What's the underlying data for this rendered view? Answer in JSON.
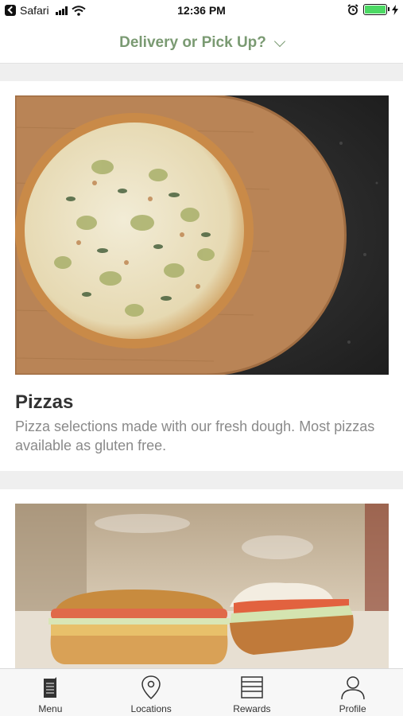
{
  "status_bar": {
    "back_app": "Safari",
    "time": "12:36 PM"
  },
  "header": {
    "title": "Delivery or Pick Up?",
    "accent_color": "#7a9a72"
  },
  "categories": [
    {
      "title": "Pizzas",
      "description": "Pizza selections made with our fresh dough. Most pizzas available as gluten free.",
      "image": "artichoke-pizza-photo"
    },
    {
      "title": "",
      "description": "",
      "image": "sub-sandwich-photo"
    }
  ],
  "tabs": [
    {
      "label": "Menu",
      "icon": "menu-icon"
    },
    {
      "label": "Locations",
      "icon": "location-pin-icon"
    },
    {
      "label": "Rewards",
      "icon": "rewards-icon"
    },
    {
      "label": "Profile",
      "icon": "profile-icon"
    }
  ]
}
